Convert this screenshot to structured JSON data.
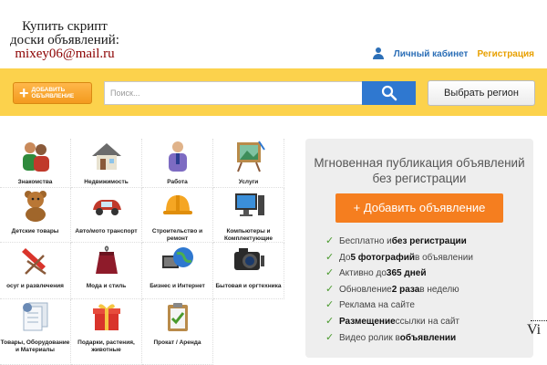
{
  "promo": {
    "line1": "Купить скрипт",
    "line2": "доски объявлений:",
    "line3": "mixey06@mail.ru"
  },
  "account": {
    "cabinet_label": "Личный кабинет",
    "register_label": "Регистрация"
  },
  "searchbar": {
    "add_label": "Добавить объявление",
    "search_placeholder": "Поиск...",
    "region_label": "Выбрать регион"
  },
  "categories": [
    {
      "label": "Знакомства",
      "icon": "people-icon"
    },
    {
      "label": "Недвижимость",
      "icon": "house-icon"
    },
    {
      "label": "Работа",
      "icon": "worker-icon"
    },
    {
      "label": "Услуги",
      "icon": "easel-icon"
    },
    {
      "label": "Детские товары",
      "icon": "teddy-bear-icon"
    },
    {
      "label": "Авто/мото транспорт",
      "icon": "car-icon"
    },
    {
      "label": "Строительство и ремонт",
      "icon": "helmet-icon"
    },
    {
      "label": "Компьютеры и Комплектующие",
      "icon": "computer-icon"
    },
    {
      "label": "осуг и развлечения",
      "icon": "beach-chair-icon"
    },
    {
      "label": "Мода и стиль",
      "icon": "dress-icon"
    },
    {
      "label": "Бизнес и Интернет",
      "icon": "globe-icon"
    },
    {
      "label": "Бытовая и оргтехника",
      "icon": "camera-icon"
    },
    {
      "label": "Товары, Оборудование и Материалы",
      "icon": "documents-icon"
    },
    {
      "label": "Подарки, растения, животные",
      "icon": "gift-icon"
    },
    {
      "label": "Прокат / Аренда",
      "icon": "clipboard-icon"
    }
  ],
  "panel": {
    "title": "Мгновенная публикация объявлений без регистрации",
    "cta_label": "+ Добавить объявление",
    "features": [
      {
        "pre": "Бесплатно и ",
        "bold": "без регистрации",
        "post": ""
      },
      {
        "pre": "До ",
        "bold": "5 фотографий",
        "post": " в объявлении"
      },
      {
        "pre": "Активно до ",
        "bold": "365 дней",
        "post": ""
      },
      {
        "pre": "Обновление ",
        "bold": "2 раза",
        "post": " в неделю"
      },
      {
        "pre": "Реклама на сайте",
        "bold": "",
        "post": ""
      },
      {
        "pre": "",
        "bold": "Размещение",
        "post": " ссылки на сайт"
      },
      {
        "pre": "Видео ролик в ",
        "bold": "объявлении",
        "post": ""
      }
    ]
  },
  "edge_text": "Vi",
  "colors": {
    "searchbar_bg": "#fcd24c",
    "add_button": "#f39a1e",
    "search_button": "#2f78d0",
    "cta": "#f57e1f",
    "link_blue": "#2c6fb7",
    "register_orange": "#e8a000",
    "check_green": "#4a9a2d"
  }
}
